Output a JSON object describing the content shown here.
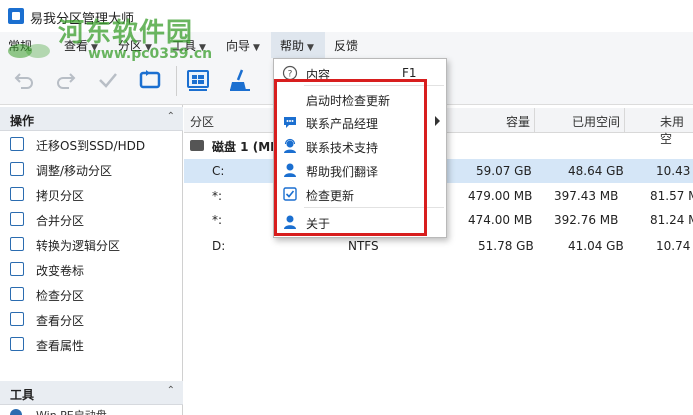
{
  "window": {
    "title": "易我分区管理大师"
  },
  "watermark": {
    "text": "河东软件园",
    "url": "www.pc0359.cn"
  },
  "menubar": {
    "items": [
      {
        "label": "常规",
        "has_caret": false
      },
      {
        "label": "查看",
        "has_caret": true
      },
      {
        "label": "分区",
        "has_caret": true
      },
      {
        "label": "工具",
        "has_caret": true
      },
      {
        "label": "向导",
        "has_caret": true
      },
      {
        "label": "帮助",
        "has_caret": true
      },
      {
        "label": "反馈",
        "has_caret": false
      }
    ],
    "caret": "▼",
    "active": "帮助"
  },
  "toolbar": {
    "buttons": [
      {
        "icon": "undo-icon",
        "enabled": false
      },
      {
        "icon": "redo-icon",
        "enabled": false
      },
      {
        "icon": "apply-check-icon",
        "enabled": false
      },
      {
        "icon": "refresh-icon",
        "enabled": true
      },
      {
        "icon": "windows-migrate-icon",
        "enabled": true
      },
      {
        "icon": "cleanup-broom-icon",
        "enabled": true
      }
    ]
  },
  "left_panel": {
    "operations_header": "操作",
    "operations": [
      {
        "label": "迁移OS到SSD/HDD",
        "icon": "migrate-os-icon"
      },
      {
        "label": "调整/移动分区",
        "icon": "resize-icon"
      },
      {
        "label": "拷贝分区",
        "icon": "copy-icon"
      },
      {
        "label": "合并分区",
        "icon": "merge-icon"
      },
      {
        "label": "转换为逻辑分区",
        "icon": "convert-icon"
      },
      {
        "label": "改变卷标",
        "icon": "label-icon"
      },
      {
        "label": "检查分区",
        "icon": "check-icon"
      },
      {
        "label": "查看分区",
        "icon": "view-icon"
      },
      {
        "label": "查看属性",
        "icon": "properties-icon"
      }
    ],
    "tools_header": "工具",
    "tools_partial_item": "Win PE启动盘",
    "collapse_glyph": "⌃"
  },
  "table": {
    "columns": {
      "partition": "分区",
      "capacity": "容量",
      "used": "已用空间",
      "unused": "未用空"
    },
    "disk_label": "磁盘 1 (MB",
    "rows": [
      {
        "name": "C:",
        "fs": "",
        "capacity": "59.07 GB",
        "used": "48.64 GB",
        "unused": "10.43",
        "selected": true
      },
      {
        "name": "*:",
        "fs": "",
        "capacity": "479.00 MB",
        "used": "397.43 MB",
        "unused": "81.57 M",
        "selected": false
      },
      {
        "name": "*:",
        "fs": "",
        "capacity": "474.00 MB",
        "used": "392.76 MB",
        "unused": "81.24 M",
        "selected": false
      },
      {
        "name": "D:",
        "fs": "NTFS",
        "capacity": "51.78 GB",
        "used": "41.04 GB",
        "unused": "10.74",
        "selected": false
      }
    ]
  },
  "help_menu": {
    "items": [
      {
        "label": "内容",
        "shortcut": "F1",
        "icon": "help-circle-icon"
      },
      {
        "label": "启动时检查更新",
        "shortcut": "",
        "icon": ""
      },
      {
        "label": "联系产品经理",
        "shortcut": "",
        "icon": "chat-bubble-icon",
        "submenu": true
      },
      {
        "label": "联系技术支持",
        "shortcut": "",
        "icon": "support-agent-icon"
      },
      {
        "label": "帮助我们翻译",
        "shortcut": "",
        "icon": "translate-person-icon"
      },
      {
        "label": "检查更新",
        "shortcut": "",
        "icon": "checkbox-checked-icon"
      },
      {
        "label": "关于",
        "shortcut": "",
        "icon": "person-icon"
      }
    ]
  },
  "colors": {
    "accent": "#1b6fd0",
    "selection": "#d5e6f7",
    "highlight_border": "#d81e1e",
    "watermark": "#3a9e2c"
  }
}
